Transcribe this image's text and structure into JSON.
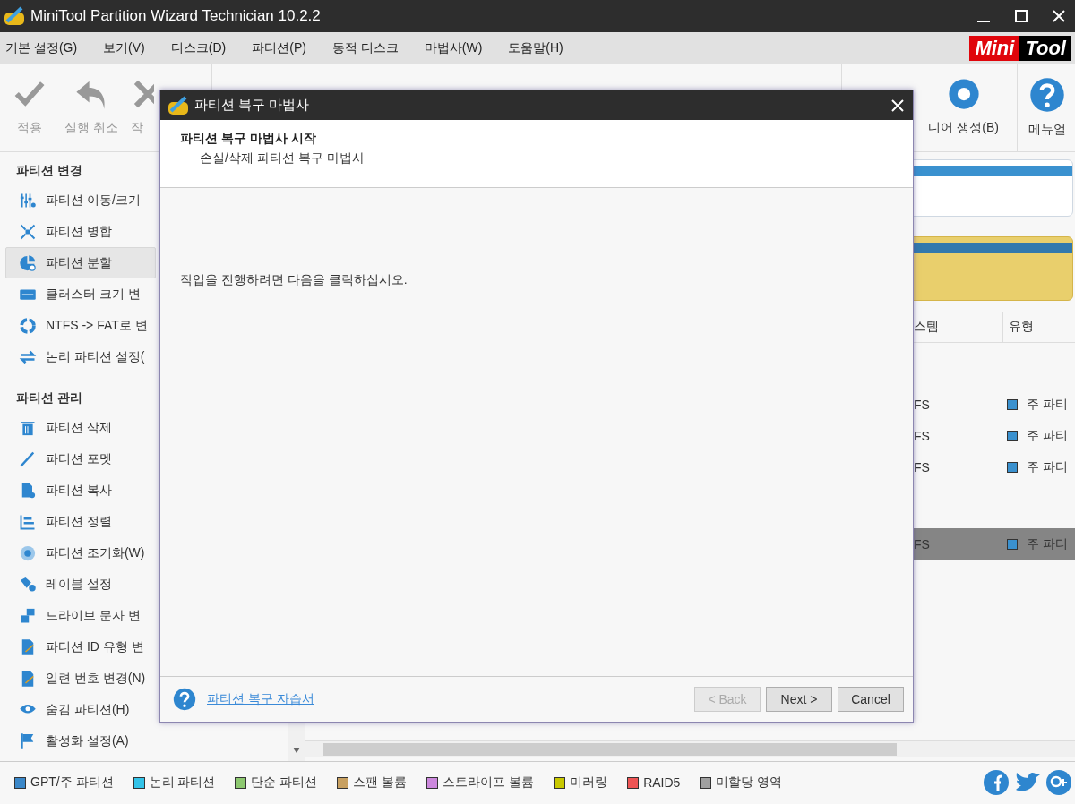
{
  "window": {
    "title": "MiniTool Partition Wizard Technician 10.2.2"
  },
  "menu": [
    "기본 설정(G)",
    "보기(V)",
    "디스크(D)",
    "파티션(P)",
    "동적 디스크",
    "마법사(W)",
    "도움말(H)"
  ],
  "logo": {
    "left": "Mini",
    "right": "Tool"
  },
  "toolbar": {
    "left": [
      {
        "label": "적용",
        "disabled": true
      },
      {
        "label": "실행 취소",
        "disabled": true
      },
      {
        "label": "작",
        "disabled": true
      }
    ],
    "right": [
      {
        "label": "디어 생성(B)",
        "disabled": false
      },
      {
        "label": "메뉴얼",
        "disabled": false
      }
    ]
  },
  "sidebar": {
    "sections": [
      {
        "title": "파티션 변경",
        "items": [
          {
            "label": "파티션 이동/크기",
            "selected": false
          },
          {
            "label": "파티션 병합",
            "selected": false
          },
          {
            "label": "파티션 분할",
            "selected": true
          },
          {
            "label": "클러스터 크기 변",
            "selected": false
          },
          {
            "label": "NTFS -> FAT로 변",
            "selected": false
          },
          {
            "label": "논리 파티션 설정(",
            "selected": false
          }
        ]
      },
      {
        "title": "파티션 관리",
        "items": [
          {
            "label": "파티션 삭제",
            "selected": false
          },
          {
            "label": "파티션 포멧",
            "selected": false
          },
          {
            "label": "파티션 복사",
            "selected": false
          },
          {
            "label": "파티션 정렬",
            "selected": false
          },
          {
            "label": "파티션 조기화(W)",
            "selected": false
          },
          {
            "label": "레이블 설정",
            "selected": false
          },
          {
            "label": "드라이브 문자 변",
            "selected": false
          },
          {
            "label": "파티션 ID 유형 변",
            "selected": false
          },
          {
            "label": "일련 번호 변경(N)",
            "selected": false
          },
          {
            "label": "숨김 파티션(H)",
            "selected": false
          },
          {
            "label": "활성화 설정(A)",
            "selected": false
          }
        ]
      }
    ]
  },
  "disk_map": [
    {
      "selected": false
    },
    {
      "selected": true
    }
  ],
  "table": {
    "columns": [
      "스템",
      "유형"
    ],
    "rows": [
      {
        "kind": "spacer"
      },
      {
        "kind": "partition",
        "file_system": "FS",
        "type": "주 파티",
        "selected": false
      },
      {
        "kind": "partition",
        "file_system": "FS",
        "type": "주 파티",
        "selected": false
      },
      {
        "kind": "partition",
        "file_system": "FS",
        "type": "주 파티",
        "selected": false
      },
      {
        "kind": "spacer"
      },
      {
        "kind": "partition",
        "file_system": "FS",
        "type": "주 파티",
        "selected": true
      }
    ]
  },
  "dialog": {
    "title": "파티션 복구 마법사",
    "heading": "파티션 복구 마법사 시작",
    "subheading": "손실/삭제 파티션 복구 마법사",
    "message": "작업을 진행하려면 다음을 클릭하십시오.",
    "help_link": "파티션 복구 자습서",
    "buttons": [
      {
        "label": "< Back",
        "disabled": true
      },
      {
        "label": "Next >",
        "disabled": false
      },
      {
        "label": "Cancel",
        "disabled": false
      }
    ]
  },
  "legend": [
    {
      "label": "GPT/주 파티션",
      "color": "#3a87c8"
    },
    {
      "label": "논리 파티션",
      "color": "#33c3e8"
    },
    {
      "label": "단순 파티션",
      "color": "#8dc870"
    },
    {
      "label": "스팬 볼륨",
      "color": "#c8a060"
    },
    {
      "label": "스트라이프 볼륨",
      "color": "#cc88dd"
    },
    {
      "label": "미러링",
      "color": "#c8c800"
    },
    {
      "label": "RAID5",
      "color": "#ee5555"
    },
    {
      "label": "미할당 영역",
      "color": "#a0a0a0"
    }
  ]
}
